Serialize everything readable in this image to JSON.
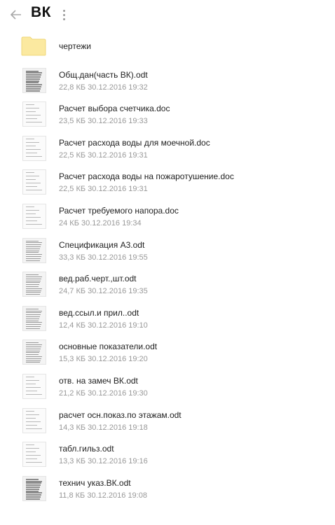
{
  "header": {
    "title": "ВК",
    "back_icon": "arrow-left-icon",
    "menu_icon": "vertical-dots-icon"
  },
  "folder": {
    "name": "чертежи",
    "icon": "folder-icon",
    "color": "#fbe9a0"
  },
  "files": [
    {
      "name": "Общ.дан(часть ВК).odt",
      "meta": "22,8 КБ  30.12.2016  19:32",
      "thumb": "dense"
    },
    {
      "name": "Расчет выбора счетчика.doc",
      "meta": "23,5 КБ  30.12.2016  19:33",
      "thumb": "light"
    },
    {
      "name": "Расчет расхода воды для моечной.doc",
      "meta": "22,5 КБ  30.12.2016  19:31",
      "thumb": "light"
    },
    {
      "name": "Расчет расхода воды на пожаротушение.doc",
      "meta": "22,5 КБ  30.12.2016  19:31",
      "thumb": "light"
    },
    {
      "name": "Расчет требуемого напора.doc",
      "meta": "24 КБ  30.12.2016  19:34",
      "thumb": "light"
    },
    {
      "name": "Спецификация А3.odt",
      "meta": "33,3 КБ  30.12.2016  19:55",
      "thumb": "table"
    },
    {
      "name": "вед.раб.черт.,шт.odt",
      "meta": "24,7 КБ  30.12.2016  19:35",
      "thumb": "table"
    },
    {
      "name": "вед.ссыл.и прил..odt",
      "meta": "12,4 КБ  30.12.2016  19:10",
      "thumb": "table"
    },
    {
      "name": "основные показатели.odt",
      "meta": "15,3 КБ  30.12.2016  19:20",
      "thumb": "table"
    },
    {
      "name": "отв. на замеч ВК.odt",
      "meta": "21,2 КБ  30.12.2016  19:30",
      "thumb": "light"
    },
    {
      "name": "расчет осн.показ.по этажам.odt",
      "meta": "14,3 КБ  30.12.2016  19:18",
      "thumb": "light"
    },
    {
      "name": "табл.гильз.odt",
      "meta": "13,3 КБ  30.12.2016  19:16",
      "thumb": "light"
    },
    {
      "name": "технич указ.ВК.odt",
      "meta": "11,8 КБ  30.12.2016  19:08",
      "thumb": "dense"
    }
  ]
}
